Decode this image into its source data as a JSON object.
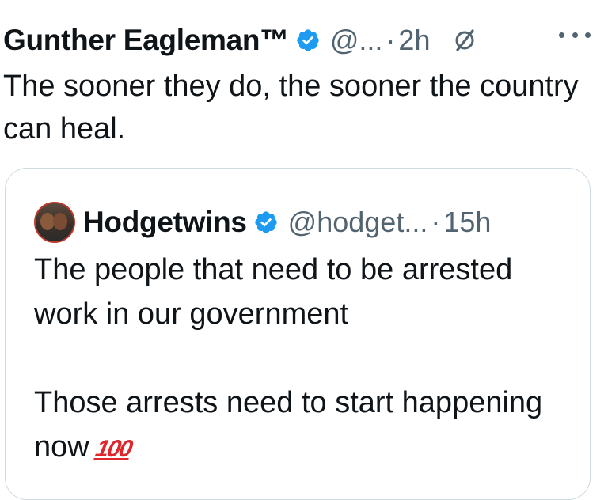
{
  "tweet": {
    "author_name": "Gunther Eagleman™",
    "handle": "@...",
    "separator": "·",
    "time": "2h",
    "text": "The sooner they do,  the sooner the country can heal."
  },
  "quoted_tweet": {
    "author_name": "Hodgetwins",
    "handle": "@hodget...",
    "separator": "·",
    "time": "15h",
    "paragraph_1": "The people that need to be arrested work in our government",
    "paragraph_2": "Those arrests need to start happening now",
    "emoji": "100"
  },
  "icons": {
    "verified": "verified-badge-icon",
    "grok": "grok-icon",
    "more": "more-options-icon"
  },
  "colors": {
    "verified_blue": "#1d9bf0",
    "text": "#0f1419",
    "secondary_text": "#536471",
    "card_border": "#cfd9de",
    "emoji_red": "#e0262d"
  }
}
